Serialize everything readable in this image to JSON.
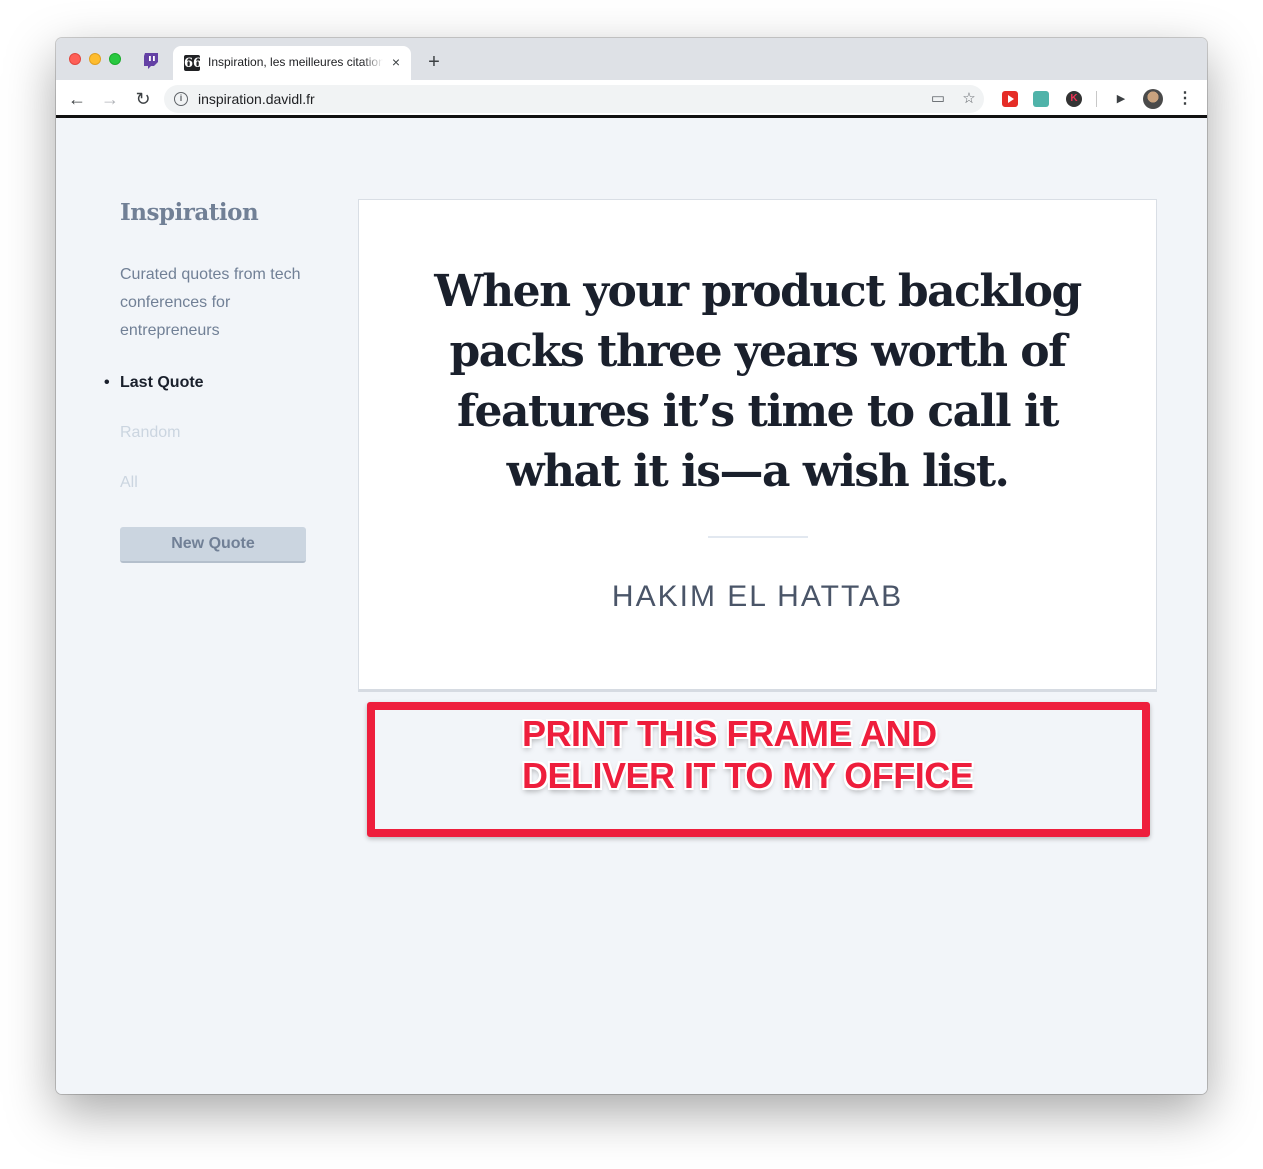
{
  "browser": {
    "tab_title": "Inspiration, les meilleures citations",
    "tab_favicon": "66",
    "url": "inspiration.davidl.fr",
    "new_tab_symbol": "+",
    "close_symbol": "×",
    "ext_k_label": "K"
  },
  "sidebar": {
    "brand": "Inspiration",
    "tagline": "Curated quotes from tech conferences for entrepreneurs",
    "nav": [
      {
        "label": "Last Quote",
        "active": true
      },
      {
        "label": "Random",
        "active": false
      },
      {
        "label": "All",
        "active": false
      }
    ],
    "button_label": "New Quote"
  },
  "quote": {
    "text": "When your product backlog packs three years worth of features it’s time to call it what it is—a wish list.",
    "author": "HAKIM EL HATTAB"
  },
  "annotation": {
    "line1": "PRINT THIS FRAME AND",
    "line2": "DELIVER IT TO MY OFFICE",
    "color": "#ee1e3c"
  },
  "colors": {
    "page_bg": "#f2f5f9",
    "text_dark": "#1a202c",
    "text_muted": "#718096",
    "nav_inactive": "#cbd5e0",
    "button_bg": "#cbd5e0"
  }
}
